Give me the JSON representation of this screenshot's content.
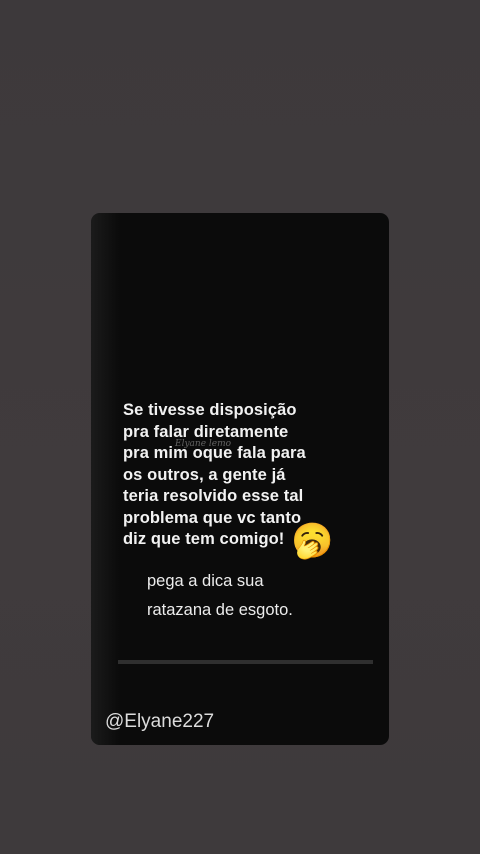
{
  "story": {
    "message": "Se tivesse disposição\npra falar diretamente\npra mim oque fala para\nos outros, a gente já\nteria resolvido esse tal\nproblema que vc tanto\ndiz que tem comigo!",
    "emoji": "🥱",
    "watermark": "Elyane lemo",
    "tip": "pega a dica sua\nratazana de esgoto.",
    "handle": "@Elyane227"
  }
}
